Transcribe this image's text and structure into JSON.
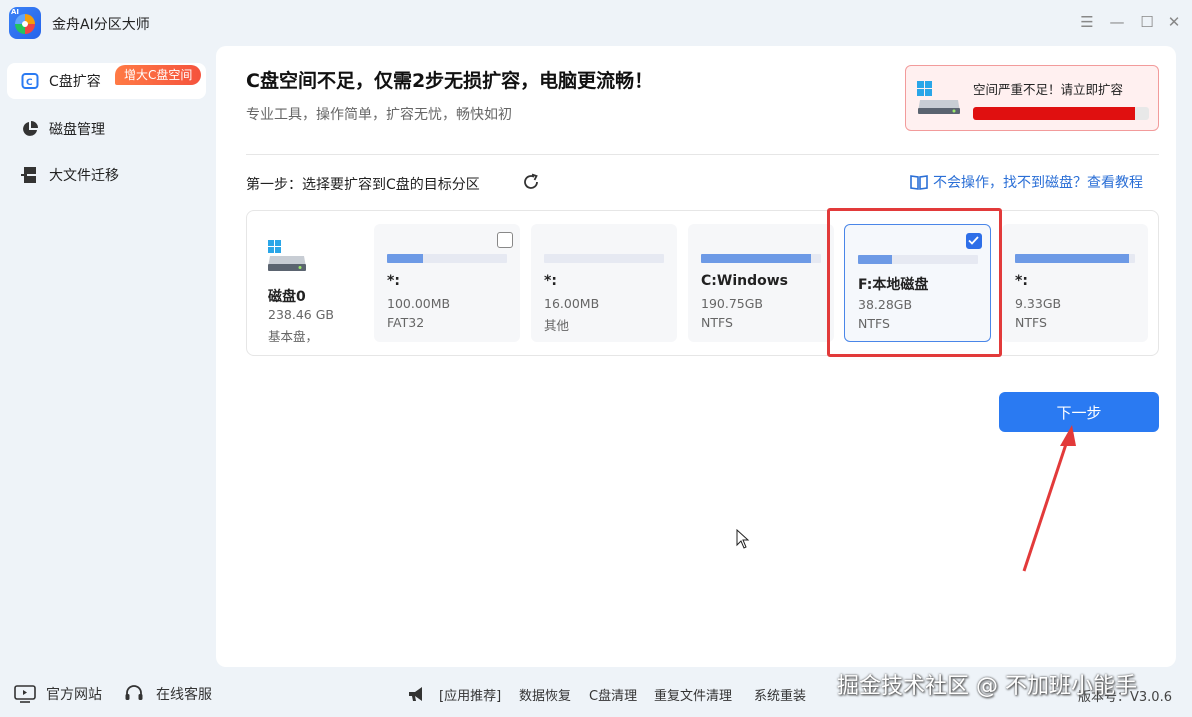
{
  "app": {
    "title": "金舟AI分区大师"
  },
  "window_controls": {
    "menu": "☰",
    "minimize": "—",
    "maximize": "☐",
    "close": "✕"
  },
  "sidebar": {
    "items": [
      {
        "label": "C盘扩容",
        "icon": "disk-c-icon",
        "active": true
      },
      {
        "label": "磁盘管理",
        "icon": "pie-chart-icon",
        "active": false
      },
      {
        "label": "大文件迁移",
        "icon": "migrate-icon",
        "active": false
      }
    ],
    "badge": "增大C盘空间"
  },
  "main": {
    "headline": "C盘空间不足，仅需2步无损扩容，电脑更流畅！",
    "subline": "专业工具，操作简单，扩容无忧，畅快如初",
    "warning": {
      "text": "空间严重不足！请立即扩容",
      "usage_fraction": 0.92,
      "color": "#e01010"
    },
    "step_label": "第一步：选择要扩容到C盘的目标分区",
    "help_link": "不会操作，找不到磁盘？查看教程",
    "disk": {
      "name": "磁盘0",
      "size": "238.46 GB",
      "type": "基本盘，"
    },
    "partitions": [
      {
        "name": "*:",
        "size": "100.00MB",
        "fs": "FAT32",
        "used_fraction": 0.3,
        "checkable": true,
        "checked": false
      },
      {
        "name": "*:",
        "size": "16.00MB",
        "fs": "其他",
        "used_fraction": 0.0,
        "checkable": false,
        "checked": false
      },
      {
        "name": "C:Windows",
        "size": "190.75GB",
        "fs": "NTFS",
        "used_fraction": 0.92,
        "checkable": false,
        "checked": false
      },
      {
        "name": "F:本地磁盘",
        "size": "38.28GB",
        "fs": "NTFS",
        "used_fraction": 0.28,
        "checkable": true,
        "checked": true
      },
      {
        "name": "*:",
        "size": "9.33GB",
        "fs": "NTFS",
        "used_fraction": 0.95,
        "checkable": false,
        "checked": false
      }
    ],
    "next_button": "下一步"
  },
  "footer": {
    "official_site": "官方网站",
    "online_service": "在线客服",
    "links": [
      "[应用推荐]",
      "数据恢复",
      "C盘清理",
      "重复文件清理",
      "系统重装"
    ],
    "version": "版本号：V3.0.6",
    "watermark": "掘金技术社区 @ 不加班小能手"
  },
  "colors": {
    "accent": "#2a7af2",
    "danger": "#e01010",
    "highlight_frame": "#e23a3a"
  }
}
